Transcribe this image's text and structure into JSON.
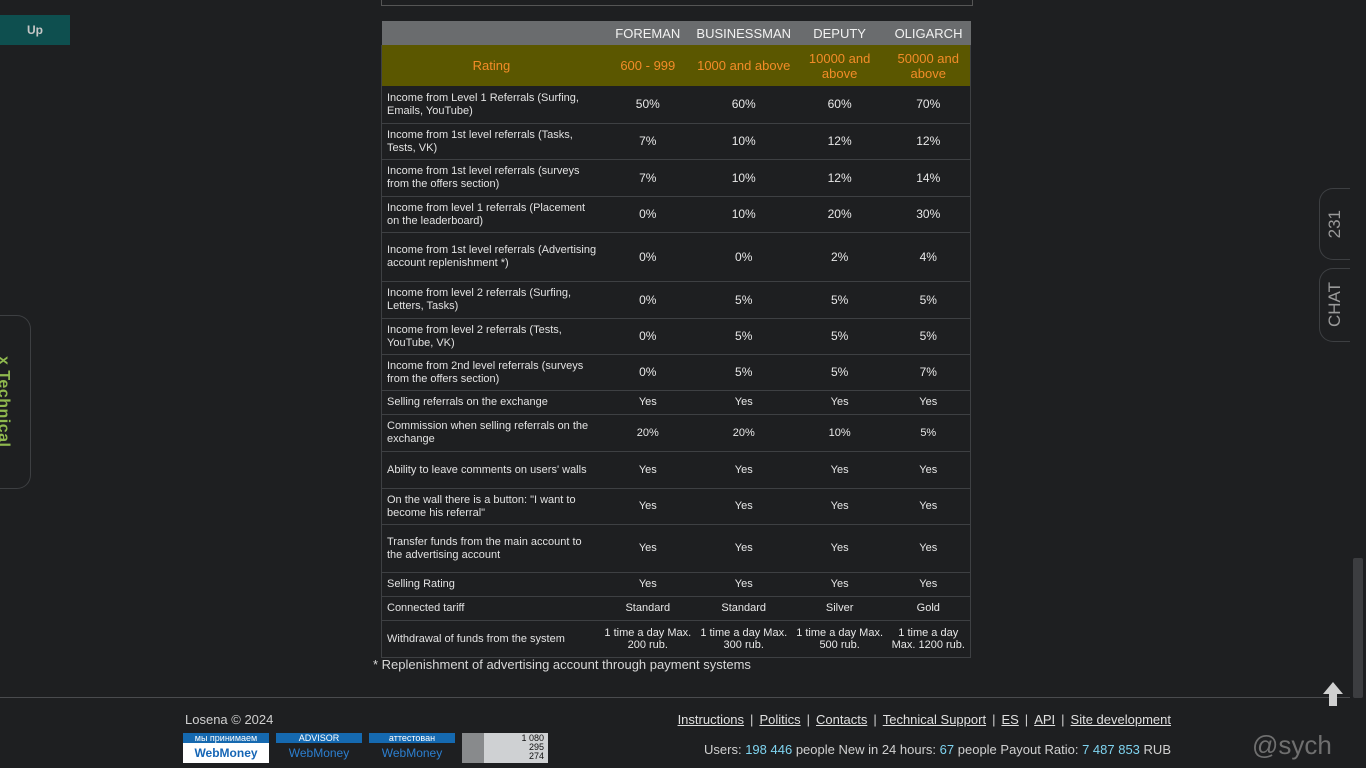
{
  "up_button": "Up",
  "left_tab": "x Technical",
  "right_tabs": {
    "count": "231",
    "chat": "CHAT"
  },
  "table": {
    "columns": [
      "FOREMAN",
      "BUSINESSMAN",
      "DEPUTY",
      "OLIGARCH"
    ],
    "rating": {
      "label": "Rating",
      "values": [
        "600 - 999",
        "1000 and above",
        "10000 and above",
        "50000 and above"
      ]
    },
    "rows": [
      {
        "label": "Income from Level 1 Referrals (Surfing, Emails, YouTube)",
        "values": [
          "50%",
          "60%",
          "60%",
          "70%"
        ]
      },
      {
        "label": "Income from 1st level referrals (Tasks, Tests, VK)",
        "values": [
          "7%",
          "10%",
          "12%",
          "12%"
        ]
      },
      {
        "label": "Income from 1st level referrals (surveys from the offers section)",
        "values": [
          "7%",
          "10%",
          "12%",
          "14%"
        ]
      },
      {
        "label": "Income from level 1 referrals (Placement on the leaderboard)",
        "values": [
          "0%",
          "10%",
          "20%",
          "30%"
        ]
      },
      {
        "label": "Income from 1st level referrals (Advertising account replenishment *)",
        "values": [
          "0%",
          "0%",
          "2%",
          "4%"
        ]
      },
      {
        "label": "Income from level 2 referrals (Surfing, Letters, Tasks)",
        "values": [
          "0%",
          "5%",
          "5%",
          "5%"
        ]
      },
      {
        "label": "Income from level 2 referrals (Tests, YouTube, VK)",
        "values": [
          "0%",
          "5%",
          "5%",
          "5%"
        ]
      },
      {
        "label": "Income from 2nd level referrals (surveys from the offers section)",
        "values": [
          "0%",
          "5%",
          "5%",
          "7%"
        ]
      },
      {
        "label": "Selling referrals on the exchange",
        "values": [
          "Yes",
          "Yes",
          "Yes",
          "Yes"
        ]
      },
      {
        "label": "Commission when selling referrals on the exchange",
        "values": [
          "20%",
          "20%",
          "10%",
          "5%"
        ]
      },
      {
        "label": "Ability to leave comments on users' walls",
        "values": [
          "Yes",
          "Yes",
          "Yes",
          "Yes"
        ]
      },
      {
        "label": "On the wall there is a button: \"I want to become his referral\"",
        "values": [
          "Yes",
          "Yes",
          "Yes",
          "Yes"
        ]
      },
      {
        "label": "Transfer funds from the main account to the advertising account",
        "values": [
          "Yes",
          "Yes",
          "Yes",
          "Yes"
        ]
      },
      {
        "label": "Selling Rating",
        "values": [
          "Yes",
          "Yes",
          "Yes",
          "Yes"
        ]
      },
      {
        "label": "Connected tariff",
        "values": [
          "Standard",
          "Standard",
          "Silver",
          "Gold"
        ]
      },
      {
        "label": "Withdrawal of funds from the system",
        "values": [
          "1 time a day Max. 200 rub.",
          "1 time a day Max. 300 rub.",
          "1 time a day Max. 500 rub.",
          "1 time a day Max. 1200 rub."
        ]
      }
    ]
  },
  "footnote": "* Replenishment of advertising account through payment systems",
  "footer": {
    "copyright": "Losena © 2024",
    "badges": [
      {
        "top": "мы принимаем",
        "bottom": "WebMoney"
      },
      {
        "top": "ADVISOR",
        "bottom": "WebMoney"
      },
      {
        "top": "аттестован",
        "bottom": "WebMoney"
      }
    ],
    "counter": [
      "1 080",
      "295",
      "274"
    ],
    "links": [
      "Instructions",
      "Politics",
      "Contacts",
      "Technical Support",
      "ES",
      "API",
      "Site development"
    ],
    "stats": {
      "users_label": "Users:",
      "users": "198 446",
      "new_label": "people New in 24 hours:",
      "new": "67",
      "payout_label": "people Payout Ratio:",
      "payout": "7 487 853",
      "currency": "RUB"
    }
  },
  "watermark": "@sych",
  "colors": {
    "rating_bg": "#5b5700",
    "rating_text": "#f28c28",
    "header_bg": "#6a6c6e",
    "stat_num": "#7fd4f0"
  }
}
